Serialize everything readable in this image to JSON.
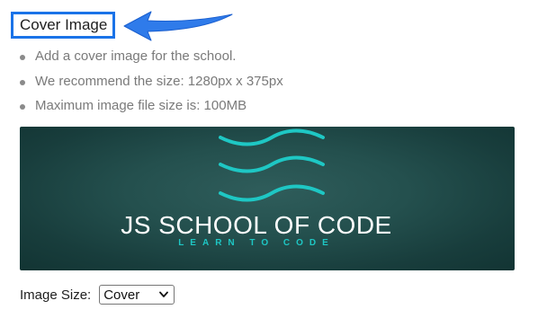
{
  "heading": {
    "label": "Cover Image"
  },
  "annotation": {
    "arrow_color": "#2f7bea",
    "highlight_color": "#1a73e8"
  },
  "info_list": [
    "Add a cover image for the school.",
    "We recommend the size: 1280px x 375px",
    "Maximum image file size is: 100MB"
  ],
  "cover": {
    "title": "JS SCHOOL OF CODE",
    "tagline": "LEARN TO CODE",
    "wave_color": "#1ec7c4",
    "background_color": "#24504e",
    "icon": "waves-icon"
  },
  "image_size": {
    "label": "Image Size:",
    "selected": "Cover"
  }
}
